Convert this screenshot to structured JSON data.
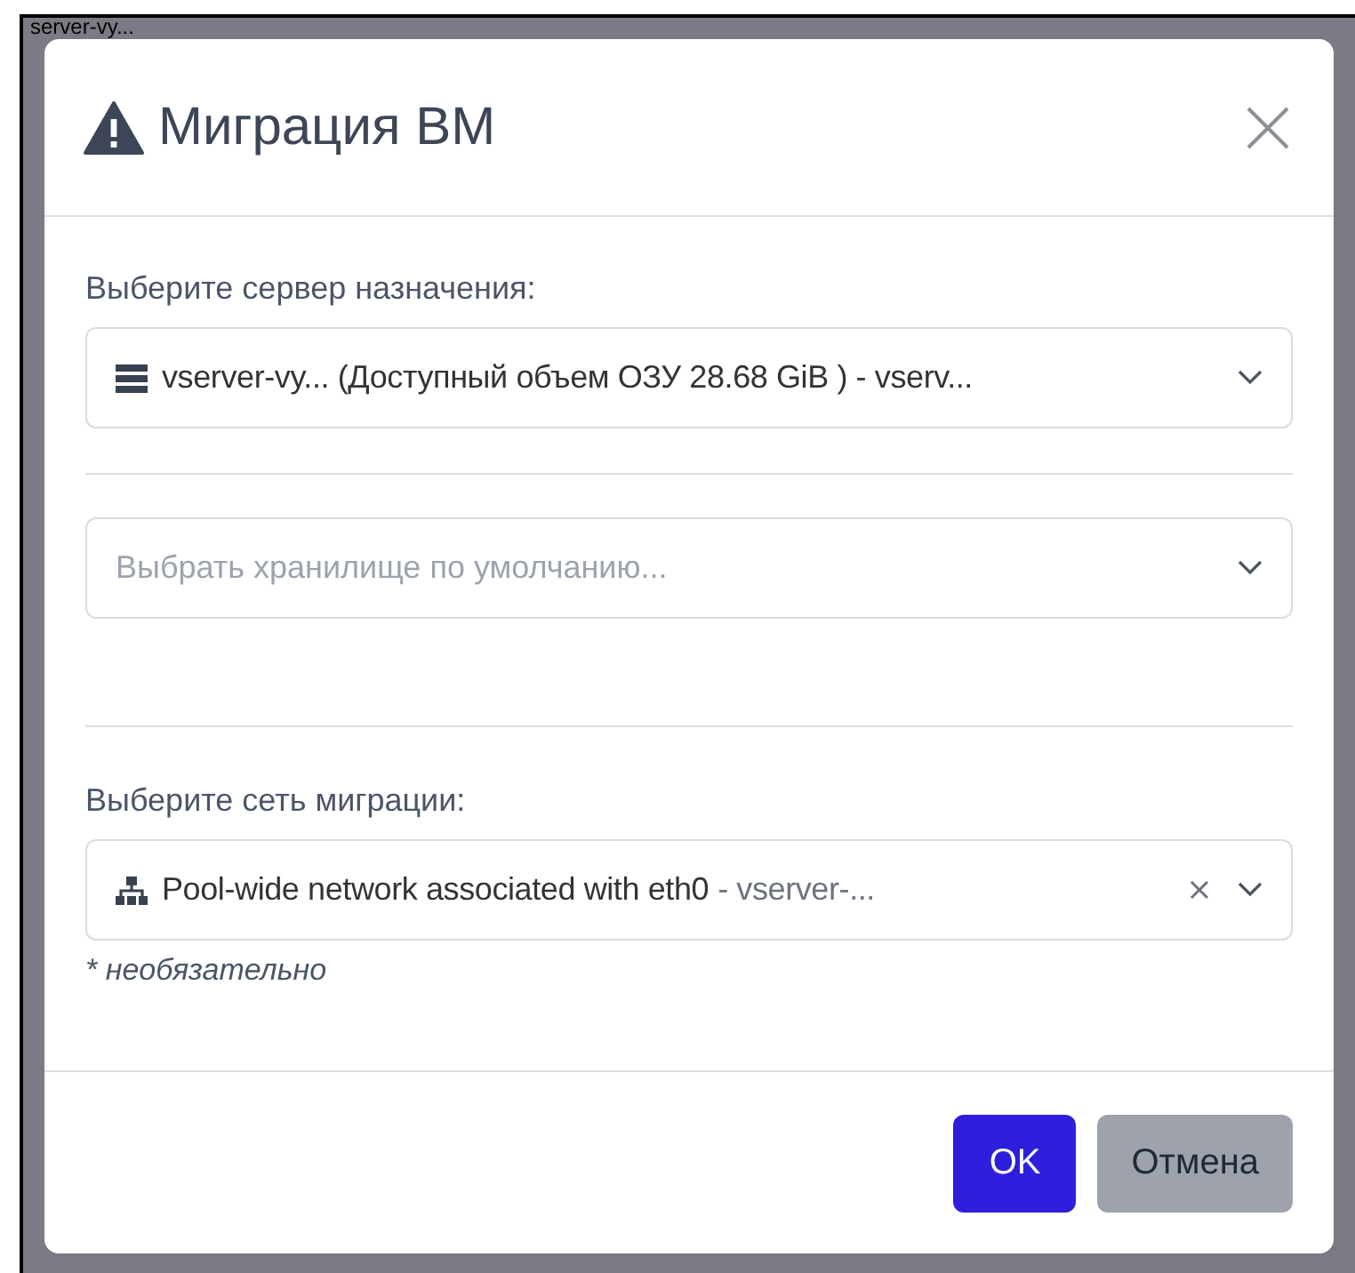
{
  "background": {
    "text": "server-vy..."
  },
  "dialog": {
    "title": "Миграция ВМ",
    "fields": [
      {
        "kind": "select",
        "label": "Выберите сервер назначения:",
        "value": "vserver-vy... (Доступный объем ОЗУ 28.68 GiB ) - vserv...",
        "clearable": false
      },
      {
        "kind": "select",
        "placeholder": "Выбрать хранилище по умолчанию...",
        "clearable": false
      },
      {
        "kind": "select",
        "label": "Выберите сеть миграции:",
        "value": "Pool-wide network associated with eth0",
        "suffix": "- vserver-...",
        "clearable": true,
        "hint": "* необязательно"
      }
    ],
    "buttons": [
      {
        "label": "OK",
        "kind": "primary"
      },
      {
        "label": "Отмена",
        "kind": "secondary"
      }
    ]
  }
}
